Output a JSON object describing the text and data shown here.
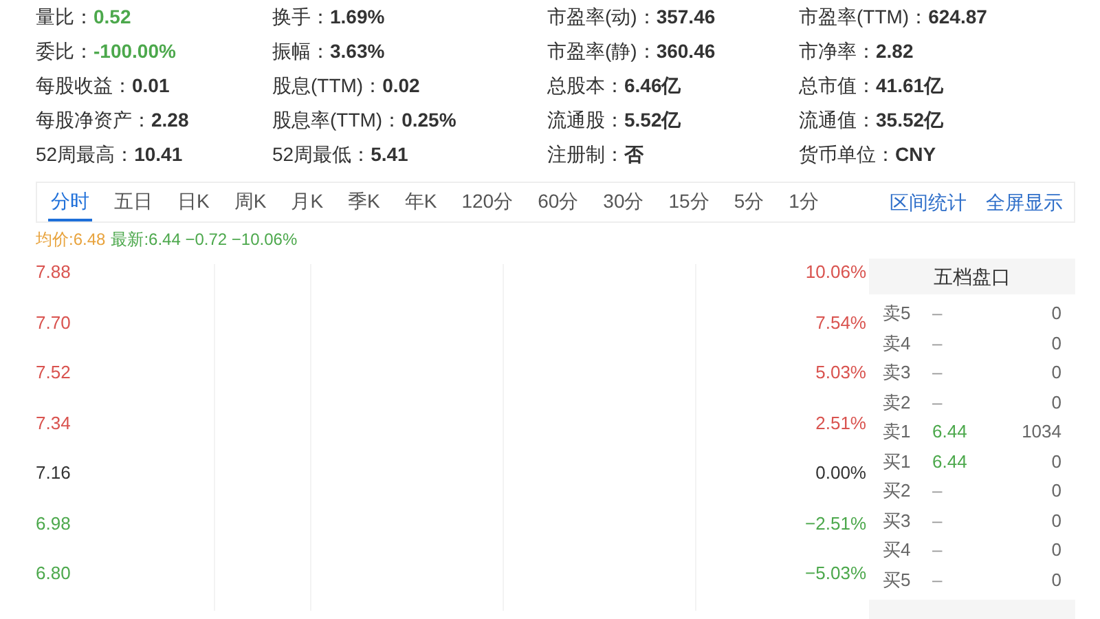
{
  "stats": [
    {
      "label": "量比：",
      "value": "0.52",
      "color": "#4ca84c"
    },
    {
      "label": "换手：",
      "value": "1.69%",
      "color": "#333333"
    },
    {
      "label": "市盈率(动)：",
      "value": "357.46",
      "color": "#333333"
    },
    {
      "label": "市盈率(TTM)：",
      "value": "624.87",
      "color": "#333333"
    },
    {
      "label": "委比：",
      "value": "-100.00%",
      "color": "#4ca84c"
    },
    {
      "label": "振幅：",
      "value": "3.63%",
      "color": "#333333"
    },
    {
      "label": "市盈率(静)：",
      "value": "360.46",
      "color": "#333333"
    },
    {
      "label": "市净率：",
      "value": "2.82",
      "color": "#333333"
    },
    {
      "label": "每股收益：",
      "value": "0.01",
      "color": "#333333"
    },
    {
      "label": "股息(TTM)：",
      "value": "0.02",
      "color": "#333333"
    },
    {
      "label": "总股本：",
      "value": "6.46亿",
      "color": "#333333"
    },
    {
      "label": "总市值：",
      "value": "41.61亿",
      "color": "#333333"
    },
    {
      "label": "每股净资产：",
      "value": "2.28",
      "color": "#333333"
    },
    {
      "label": "股息率(TTM)：",
      "value": "0.25%",
      "color": "#333333"
    },
    {
      "label": "流通股：",
      "value": "5.52亿",
      "color": "#333333"
    },
    {
      "label": "流通值：",
      "value": "35.52亿",
      "color": "#333333"
    },
    {
      "label": "52周最高：",
      "value": "10.41",
      "color": "#333333"
    },
    {
      "label": "52周最低：",
      "value": "5.41",
      "color": "#333333"
    },
    {
      "label": "注册制：",
      "value": "否",
      "color": "#333333"
    },
    {
      "label": "货币单位：",
      "value": "CNY",
      "color": "#333333"
    }
  ],
  "period_tabs": [
    {
      "label": "分时",
      "selected": true
    },
    {
      "label": "五日",
      "selected": false
    },
    {
      "label": "日K",
      "selected": false
    },
    {
      "label": "周K",
      "selected": false
    },
    {
      "label": "月K",
      "selected": false
    },
    {
      "label": "季K",
      "selected": false
    },
    {
      "label": "年K",
      "selected": false
    },
    {
      "label": "120分",
      "selected": false
    },
    {
      "label": "60分",
      "selected": false
    },
    {
      "label": "30分",
      "selected": false
    },
    {
      "label": "15分",
      "selected": false
    },
    {
      "label": "5分",
      "selected": false
    },
    {
      "label": "1分",
      "selected": false
    }
  ],
  "chart_links": [
    "区间统计",
    "全屏显示"
  ],
  "legend": {
    "average": "均价:6.48",
    "latest": "最新:6.44 −0.72 −10.06%"
  },
  "chart_axis": [
    {
      "price": "7.88",
      "percent": "10.06%",
      "color": "#d9534f"
    },
    {
      "price": "7.70",
      "percent": "7.54%",
      "color": "#d9534f"
    },
    {
      "price": "7.52",
      "percent": "5.03%",
      "color": "#d9534f"
    },
    {
      "price": "7.34",
      "percent": "2.51%",
      "color": "#d9534f"
    },
    {
      "price": "7.16",
      "percent": "0.00%",
      "color": "#333333"
    },
    {
      "price": "6.98",
      "percent": "−2.51%",
      "color": "#4ca84c"
    },
    {
      "price": "6.80",
      "percent": "−5.03%",
      "color": "#4ca84c"
    }
  ],
  "order_book": {
    "title": "五档盘口",
    "rows": [
      {
        "label": "卖5",
        "price": "–",
        "volume": "0"
      },
      {
        "label": "卖4",
        "price": "–",
        "volume": "0"
      },
      {
        "label": "卖3",
        "price": "–",
        "volume": "0"
      },
      {
        "label": "卖2",
        "price": "–",
        "volume": "0"
      },
      {
        "label": "卖1",
        "price": "6.44",
        "volume": "1034"
      },
      {
        "label": "买1",
        "price": "6.44",
        "volume": "0"
      },
      {
        "label": "买2",
        "price": "–",
        "volume": "0"
      },
      {
        "label": "买3",
        "price": "–",
        "volume": "0"
      },
      {
        "label": "买4",
        "price": "–",
        "volume": "0"
      },
      {
        "label": "买5",
        "price": "–",
        "volume": "0"
      }
    ]
  }
}
